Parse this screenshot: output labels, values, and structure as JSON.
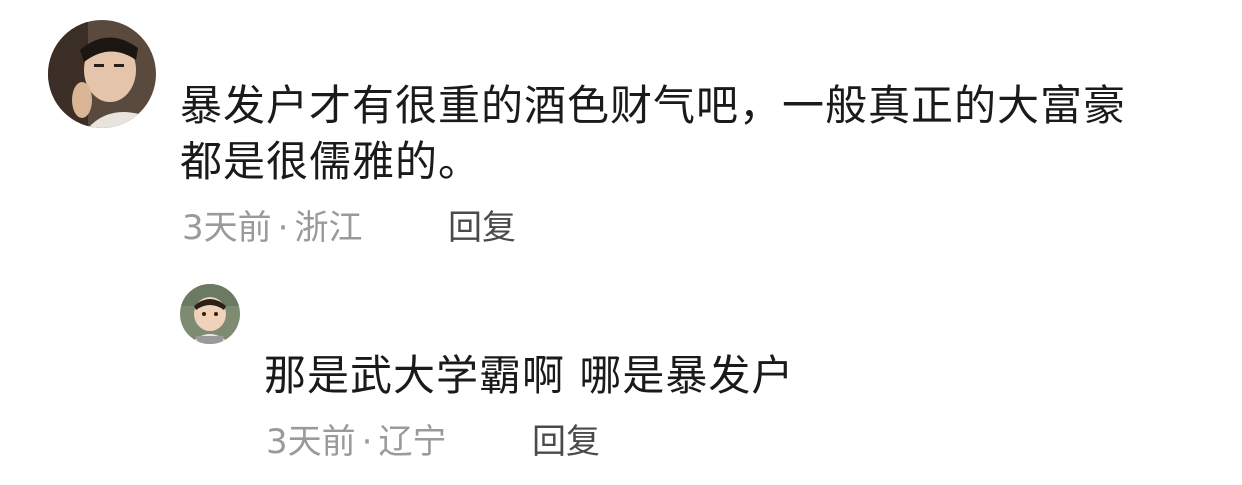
{
  "comments": [
    {
      "text_line1": "暴发户才有很重的酒色财气吧，一般真正的大富豪",
      "text_line2": "都是很儒雅的。",
      "time": "3天前",
      "separator": "·",
      "location": "浙江",
      "reply_label": "回复"
    }
  ],
  "replies": [
    {
      "username": "",
      "text": "那是武大学霸啊 哪是暴发户",
      "time": "3天前",
      "separator": "·",
      "location": "辽宁",
      "reply_label": "回复"
    }
  ]
}
